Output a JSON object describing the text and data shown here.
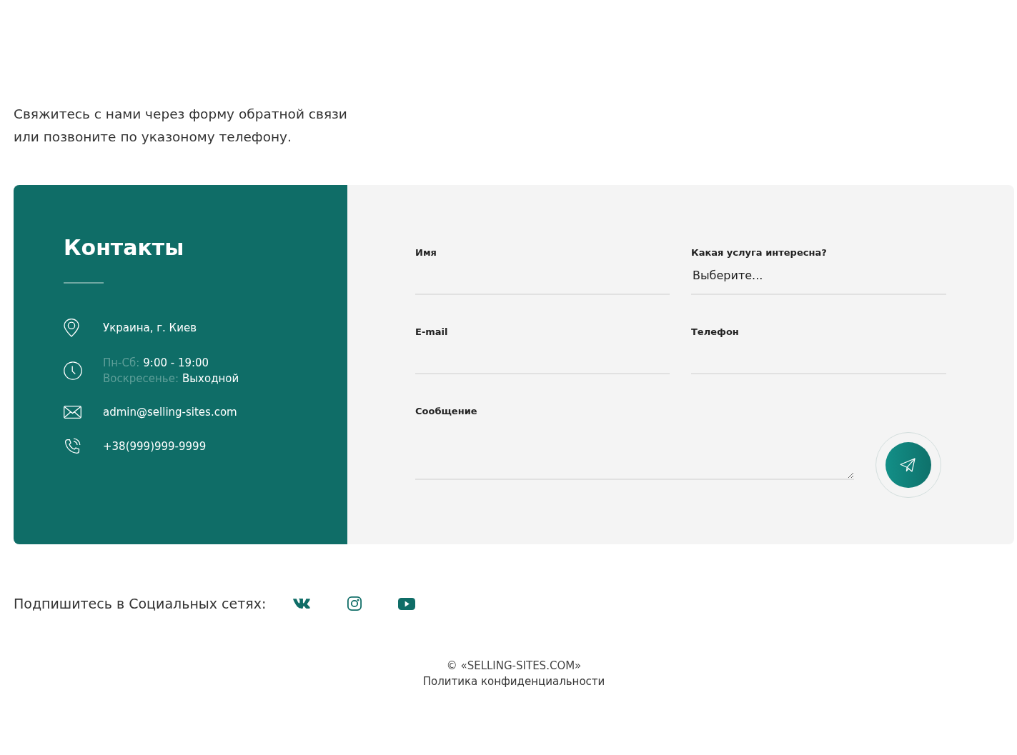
{
  "intro": "Свяжитесь с нами через форму обратной связи\nили позвоните по указоному телефону.",
  "contacts": {
    "title": "Контакты",
    "items": [
      {
        "kind": "address",
        "text": "Украина, г. Киев"
      },
      {
        "kind": "hours",
        "lines": [
          {
            "label": "Пн-Сб:",
            "value": "9:00 - 19:00"
          },
          {
            "label": "Воскресенье:",
            "value": "Выходной"
          }
        ]
      },
      {
        "kind": "email",
        "text": "admin@selling-sites.com"
      },
      {
        "kind": "phone",
        "text": "+38(999)999-9999"
      }
    ]
  },
  "form": {
    "fields": [
      {
        "kind": "input",
        "label": "Имя"
      },
      {
        "kind": "select",
        "label": "Какая услуга интересна?",
        "value": "Выберите..."
      },
      {
        "kind": "input",
        "label": "E-mail"
      },
      {
        "kind": "input",
        "label": "Телефон"
      },
      {
        "kind": "textarea",
        "label": "Сообщение"
      }
    ]
  },
  "social": {
    "label": "Подпишитесь в Социальных сетях:"
  },
  "footer": {
    "copyright": "© «SELLING-SITES.COM»",
    "privacy_link": "Политика конфиденциальности"
  }
}
